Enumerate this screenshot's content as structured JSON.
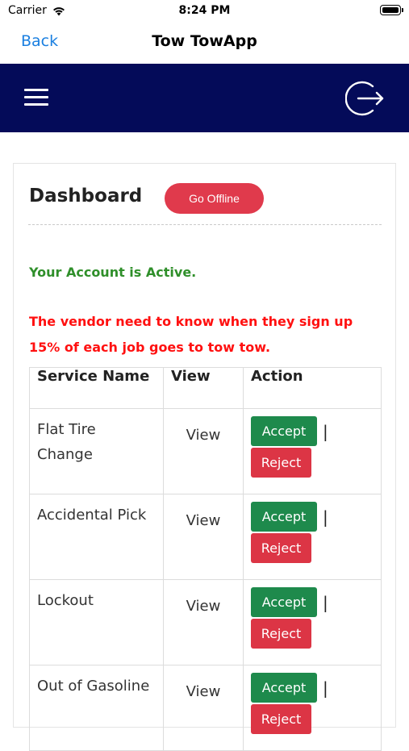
{
  "status_bar": {
    "carrier": "Carrier",
    "time": "8:24 PM"
  },
  "nav": {
    "back_label": "Back",
    "title": "Tow TowApp"
  },
  "dashboard": {
    "title": "Dashboard",
    "go_offline_label": "Go Offline",
    "active_message": "Your Account is Active.",
    "warning_message": "The vendor need to know when they sign up 15% of each job goes to tow tow."
  },
  "table": {
    "headers": [
      "Service Name",
      "View",
      "Action"
    ],
    "rows": [
      {
        "service": "Flat Tire Change",
        "view": "View",
        "accept": "Accept",
        "separator": "|",
        "reject": "Reject"
      },
      {
        "service": "Accidental Pick",
        "view": "View",
        "accept": "Accept",
        "separator": "|",
        "reject": "Reject"
      },
      {
        "service": "Lockout",
        "view": "View",
        "accept": "Accept",
        "separator": "|",
        "reject": "Reject"
      },
      {
        "service": "Out of Gasoline",
        "view": "View",
        "accept": "Accept",
        "separator": "|",
        "reject": "Reject"
      }
    ]
  },
  "colors": {
    "header_bg": "#040b59",
    "go_offline": "#e03a4c",
    "active": "#2f8f2a",
    "warning": "#ff1010",
    "accept": "#1e8a4c",
    "reject": "#dc3545",
    "link": "#1a7fe0"
  },
  "icons": {
    "menu": "hamburger-menu-icon",
    "logout": "logout-icon",
    "wifi": "wifi-icon",
    "battery": "battery-icon"
  }
}
